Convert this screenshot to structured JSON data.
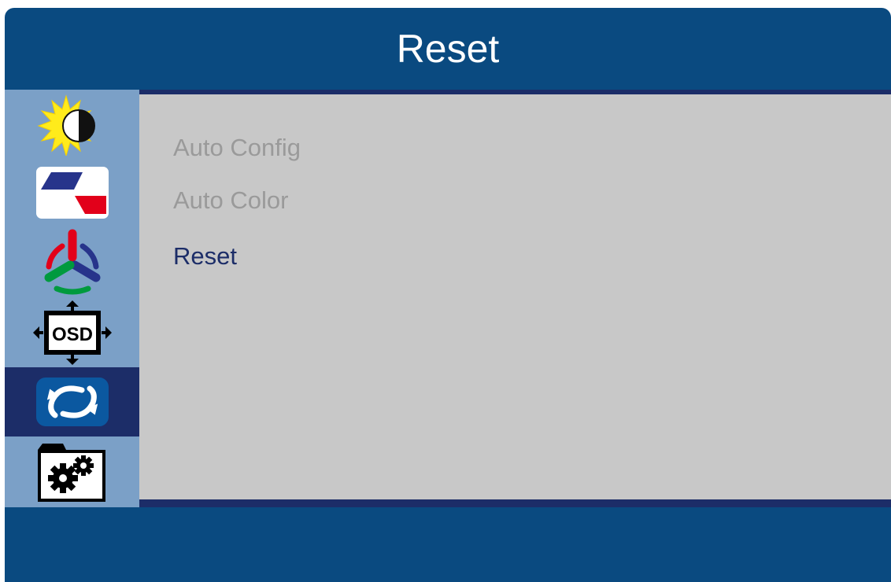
{
  "header": {
    "title": "Reset"
  },
  "sidebar": {
    "items": [
      {
        "icon": "brightness-contrast-icon",
        "selected": false
      },
      {
        "icon": "image-adjust-icon",
        "selected": false
      },
      {
        "icon": "color-settings-icon",
        "selected": false
      },
      {
        "icon": "osd-settings-icon",
        "osd_text": "OSD",
        "selected": false
      },
      {
        "icon": "reset-icon",
        "selected": true
      },
      {
        "icon": "extra-settings-icon",
        "selected": false
      }
    ]
  },
  "menu": {
    "items": [
      {
        "label": "Auto Config",
        "enabled": false
      },
      {
        "label": "Auto Color",
        "enabled": false
      },
      {
        "label": "Reset",
        "enabled": true,
        "selected": true
      }
    ]
  },
  "colors": {
    "frame": "#0a4a80",
    "sidebar": "#7ba0c7",
    "selected": "#1c2d68",
    "content": "#c8c8c8",
    "item_disabled": "#9a9a9a",
    "item_active": "#1c2d68"
  }
}
